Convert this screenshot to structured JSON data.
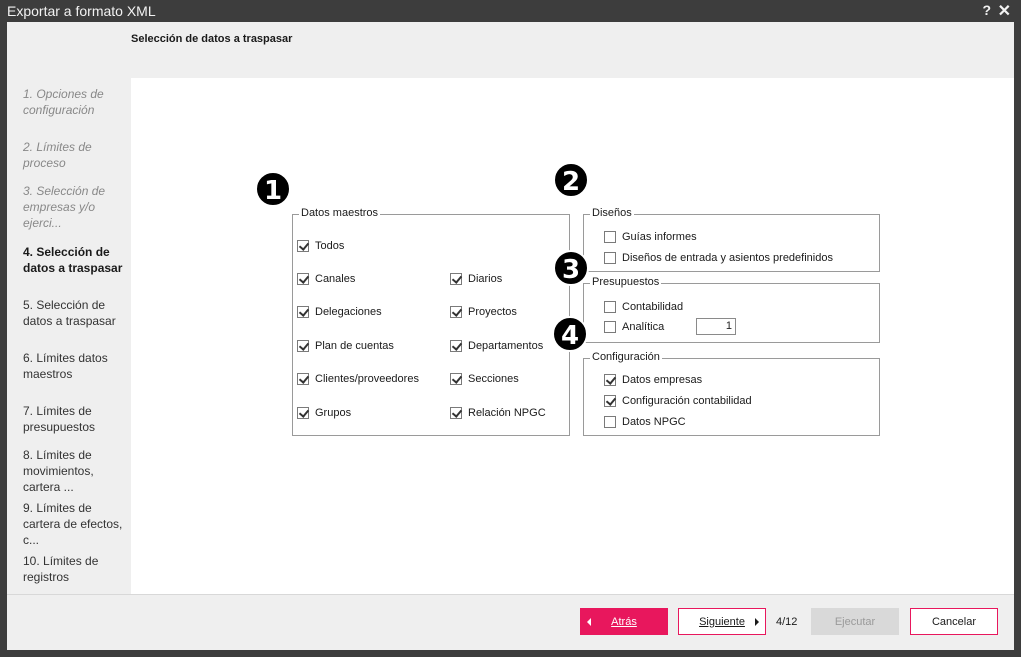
{
  "window": {
    "title": "Exportar a formato XML",
    "help": "?",
    "close": "✕"
  },
  "header": {
    "title": "Selección de datos a traspasar"
  },
  "steps": [
    {
      "label": "1. Opciones de configuración",
      "state": "done"
    },
    {
      "label": "2. Límites de proceso",
      "state": "done"
    },
    {
      "label": "3. Selección de empresas y/o ejerci...",
      "state": "done"
    },
    {
      "label": "4. Selección de datos a traspasar",
      "state": "current"
    },
    {
      "label": "5. Selección de datos a traspasar",
      "state": "pending"
    },
    {
      "label": "6. Límites datos maestros",
      "state": "pending"
    },
    {
      "label": "7. Límites de presupuestos",
      "state": "pending"
    },
    {
      "label": "8. Límites de movimientos, cartera ...",
      "state": "pending"
    },
    {
      "label": "9. Límites de cartera de efectos, c...",
      "state": "pending"
    },
    {
      "label": "10. Límites de registros",
      "state": "pending"
    }
  ],
  "badges": [
    "1",
    "2",
    "3",
    "4"
  ],
  "groups": {
    "datos_maestros": {
      "legend": "Datos maestros",
      "todos": {
        "label": "Todos",
        "checked": true
      },
      "items": [
        {
          "label": "Canales",
          "checked": true
        },
        {
          "label": "Diarios",
          "checked": true
        },
        {
          "label": "Delegaciones",
          "checked": true
        },
        {
          "label": "Proyectos",
          "checked": true
        },
        {
          "label": "Plan de cuentas",
          "checked": true
        },
        {
          "label": "Departamentos",
          "checked": true
        },
        {
          "label": "Clientes/proveedores",
          "checked": true
        },
        {
          "label": "Secciones",
          "checked": true
        },
        {
          "label": "Grupos",
          "checked": true
        },
        {
          "label": "Relación NPGC",
          "checked": true
        }
      ]
    },
    "disenos": {
      "legend": "Diseños",
      "items": [
        {
          "label": "Guías informes",
          "checked": false
        },
        {
          "label": "Diseños de entrada y asientos predefinidos",
          "checked": false
        }
      ]
    },
    "presupuestos": {
      "legend": "Presupuestos",
      "items": [
        {
          "label": "Contabilidad",
          "checked": false
        },
        {
          "label": "Analítica",
          "checked": false
        }
      ],
      "analitica_value": "1"
    },
    "configuracion": {
      "legend": "Configuración",
      "items": [
        {
          "label": "Datos empresas",
          "checked": true
        },
        {
          "label": "Configuración contabilidad",
          "checked": true
        },
        {
          "label": "Datos NPGC",
          "checked": false
        }
      ]
    }
  },
  "footer": {
    "back_label": "Atrás",
    "next_label": "Siguiente",
    "page_count": "4/12",
    "run_label": "Ejecutar",
    "cancel_label": "Cancelar"
  },
  "colors": {
    "accent": "#e8175d",
    "titlebar": "#3d3d3d",
    "panel": "#efefef",
    "disabled": "#d9d9d9"
  }
}
